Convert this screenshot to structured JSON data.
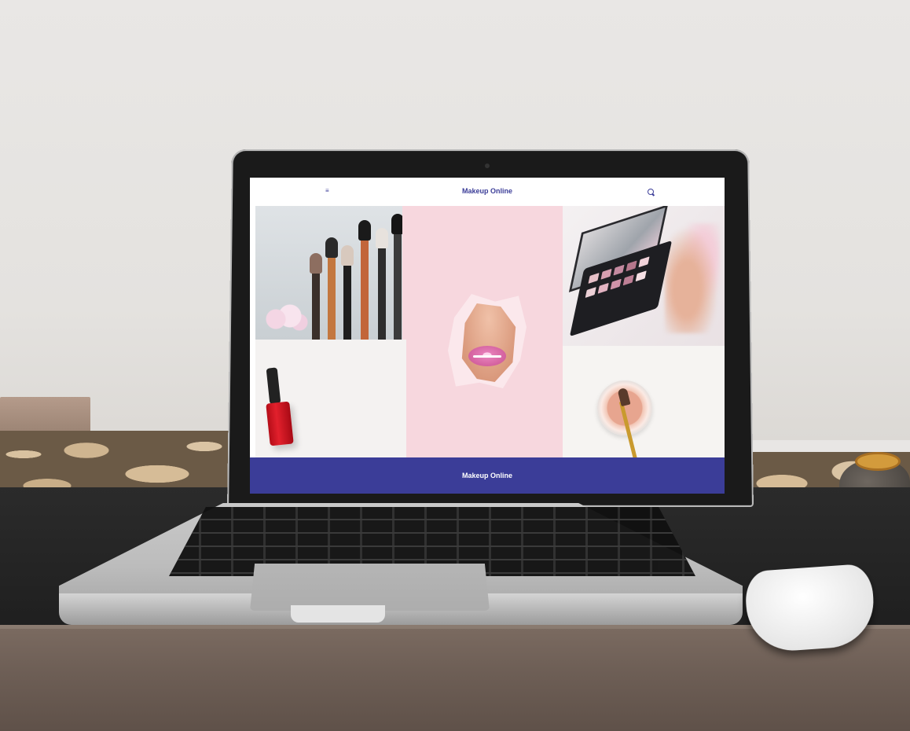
{
  "site": {
    "brand": "Makeup Online",
    "footer_brand": "Makeup Online"
  },
  "header": {
    "menu_icon": "hamburger-menu-icon",
    "search_icon": "search-icon"
  },
  "tiles": [
    {
      "id": "brushes",
      "description_icon": "makeup-brushes-image"
    },
    {
      "id": "lips",
      "description_icon": "pink-lips-image"
    },
    {
      "id": "palette",
      "description_icon": "eyeshadow-palette-image"
    },
    {
      "id": "polish",
      "description_icon": "nail-polish-image"
    },
    {
      "id": "powder",
      "description_icon": "powder-jar-image"
    }
  ],
  "colors": {
    "brand": "#3b3d98",
    "background": "#ffffff"
  }
}
